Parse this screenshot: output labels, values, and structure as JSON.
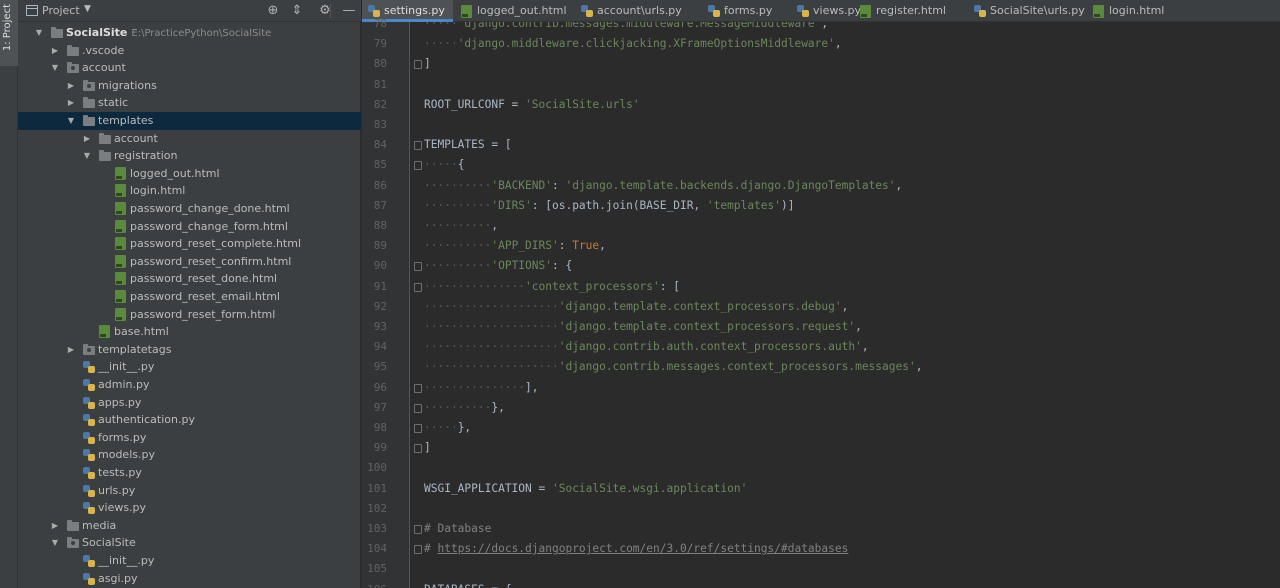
{
  "tool_strip": {
    "label": "1: Project"
  },
  "project_panel": {
    "title": "Project",
    "tree": [
      {
        "label": "SocialSite",
        "hint": "E:\\PracticePython\\SocialSite",
        "depth": 0,
        "kind": "folder",
        "expanded": true,
        "bold": true
      },
      {
        "label": ".vscode",
        "depth": 1,
        "kind": "folder",
        "expanded": false
      },
      {
        "label": "account",
        "depth": 1,
        "kind": "folder-pkg",
        "expanded": true
      },
      {
        "label": "migrations",
        "depth": 2,
        "kind": "folder-pkg",
        "expanded": false
      },
      {
        "label": "static",
        "depth": 2,
        "kind": "folder",
        "expanded": false
      },
      {
        "label": "templates",
        "depth": 2,
        "kind": "folder",
        "expanded": true,
        "selected": true
      },
      {
        "label": "account",
        "depth": 3,
        "kind": "folder",
        "expanded": false
      },
      {
        "label": "registration",
        "depth": 3,
        "kind": "folder",
        "expanded": true
      },
      {
        "label": "logged_out.html",
        "depth": 4,
        "kind": "html"
      },
      {
        "label": "login.html",
        "depth": 4,
        "kind": "html"
      },
      {
        "label": "password_change_done.html",
        "depth": 4,
        "kind": "html"
      },
      {
        "label": "password_change_form.html",
        "depth": 4,
        "kind": "html"
      },
      {
        "label": "password_reset_complete.html",
        "depth": 4,
        "kind": "html"
      },
      {
        "label": "password_reset_confirm.html",
        "depth": 4,
        "kind": "html"
      },
      {
        "label": "password_reset_done.html",
        "depth": 4,
        "kind": "html"
      },
      {
        "label": "password_reset_email.html",
        "depth": 4,
        "kind": "html"
      },
      {
        "label": "password_reset_form.html",
        "depth": 4,
        "kind": "html"
      },
      {
        "label": "base.html",
        "depth": 3,
        "kind": "html"
      },
      {
        "label": "templatetags",
        "depth": 2,
        "kind": "folder-pkg",
        "expanded": false
      },
      {
        "label": "__init__.py",
        "depth": 2,
        "kind": "py"
      },
      {
        "label": "admin.py",
        "depth": 2,
        "kind": "py"
      },
      {
        "label": "apps.py",
        "depth": 2,
        "kind": "py"
      },
      {
        "label": "authentication.py",
        "depth": 2,
        "kind": "py"
      },
      {
        "label": "forms.py",
        "depth": 2,
        "kind": "py"
      },
      {
        "label": "models.py",
        "depth": 2,
        "kind": "py"
      },
      {
        "label": "tests.py",
        "depth": 2,
        "kind": "py"
      },
      {
        "label": "urls.py",
        "depth": 2,
        "kind": "py"
      },
      {
        "label": "views.py",
        "depth": 2,
        "kind": "py"
      },
      {
        "label": "media",
        "depth": 1,
        "kind": "folder",
        "expanded": false
      },
      {
        "label": "SocialSite",
        "depth": 1,
        "kind": "folder-pkg",
        "expanded": true
      },
      {
        "label": "__init__.py",
        "depth": 2,
        "kind": "py"
      },
      {
        "label": "asgi.py",
        "depth": 2,
        "kind": "py"
      }
    ]
  },
  "tabs": [
    {
      "label": "settings.py",
      "kind": "py",
      "active": true
    },
    {
      "label": "logged_out.html",
      "kind": "html"
    },
    {
      "label": "account\\urls.py",
      "kind": "py"
    },
    {
      "label": "forms.py",
      "kind": "py"
    },
    {
      "label": "views.py",
      "kind": "py"
    },
    {
      "label": "register.html",
      "kind": "html"
    },
    {
      "label": "SocialSite\\urls.py",
      "kind": "py"
    },
    {
      "label": "login.html",
      "kind": "html"
    }
  ],
  "editor": {
    "lines": [
      {
        "n": "78",
        "indent": 1,
        "tokens": [
          [
            "str",
            "'django.contrib.messages.middleware.MessageMiddleware'"
          ],
          [
            "id",
            ","
          ]
        ]
      },
      {
        "n": "79",
        "indent": 1,
        "tokens": [
          [
            "str",
            "'django.middleware.clickjacking.XFrameOptionsMiddleware'"
          ],
          [
            "id",
            ","
          ]
        ]
      },
      {
        "n": "80",
        "indent": 0,
        "tokens": [
          [
            "id",
            "]"
          ]
        ],
        "fold": true
      },
      {
        "n": "81",
        "indent": 0,
        "tokens": []
      },
      {
        "n": "82",
        "indent": 0,
        "tokens": [
          [
            "id",
            "ROOT_URLCONF = "
          ],
          [
            "str",
            "'SocialSite.urls'"
          ]
        ]
      },
      {
        "n": "83",
        "indent": 0,
        "tokens": []
      },
      {
        "n": "84",
        "indent": 0,
        "tokens": [
          [
            "id",
            "TEMPLATES = ["
          ]
        ],
        "fold": true
      },
      {
        "n": "85",
        "indent": 1,
        "tokens": [
          [
            "id",
            "{"
          ]
        ],
        "fold": true
      },
      {
        "n": "86",
        "indent": 2,
        "tokens": [
          [
            "str",
            "'BACKEND'"
          ],
          [
            "id",
            ": "
          ],
          [
            "str",
            "'django.template.backends.django.DjangoTemplates'"
          ],
          [
            "id",
            ","
          ]
        ]
      },
      {
        "n": "87",
        "indent": 2,
        "tokens": [
          [
            "str",
            "'DIRS'"
          ],
          [
            "id",
            ": [os.path.join(BASE_DIR, "
          ],
          [
            "str",
            "'templates'"
          ],
          [
            "id",
            ")]"
          ]
        ]
      },
      {
        "n": "88",
        "indent": 2,
        "tokens": [
          [
            "id",
            ","
          ]
        ]
      },
      {
        "n": "89",
        "indent": 2,
        "tokens": [
          [
            "str",
            "'APP_DIRS'"
          ],
          [
            "id",
            ": "
          ],
          [
            "kw",
            "True"
          ],
          [
            "id",
            ","
          ]
        ]
      },
      {
        "n": "90",
        "indent": 2,
        "tokens": [
          [
            "str",
            "'OPTIONS'"
          ],
          [
            "id",
            ": {"
          ]
        ],
        "fold": true
      },
      {
        "n": "91",
        "indent": 3,
        "tokens": [
          [
            "str",
            "'context_processors'"
          ],
          [
            "id",
            ": ["
          ]
        ],
        "fold": true
      },
      {
        "n": "92",
        "indent": 4,
        "tokens": [
          [
            "str",
            "'django.template.context_processors.debug'"
          ],
          [
            "id",
            ","
          ]
        ]
      },
      {
        "n": "93",
        "indent": 4,
        "tokens": [
          [
            "str",
            "'django.template.context_processors.request'"
          ],
          [
            "id",
            ","
          ]
        ]
      },
      {
        "n": "94",
        "indent": 4,
        "tokens": [
          [
            "str",
            "'django.contrib.auth.context_processors.auth'"
          ],
          [
            "id",
            ","
          ]
        ]
      },
      {
        "n": "95",
        "indent": 4,
        "tokens": [
          [
            "str",
            "'django.contrib.messages.context_processors.messages'"
          ],
          [
            "id",
            ","
          ]
        ]
      },
      {
        "n": "96",
        "indent": 3,
        "tokens": [
          [
            "id",
            "],"
          ]
        ],
        "fold": true
      },
      {
        "n": "97",
        "indent": 2,
        "tokens": [
          [
            "id",
            "},"
          ]
        ],
        "fold": true
      },
      {
        "n": "98",
        "indent": 1,
        "tokens": [
          [
            "id",
            "},"
          ]
        ],
        "fold": true
      },
      {
        "n": "99",
        "indent": 0,
        "tokens": [
          [
            "id",
            "]"
          ]
        ],
        "fold": true
      },
      {
        "n": "100",
        "indent": 0,
        "tokens": []
      },
      {
        "n": "101",
        "indent": 0,
        "tokens": [
          [
            "id",
            "WSGI_APPLICATION = "
          ],
          [
            "str",
            "'SocialSite.wsgi.application'"
          ]
        ]
      },
      {
        "n": "102",
        "indent": 0,
        "tokens": []
      },
      {
        "n": "103",
        "indent": 0,
        "tokens": [
          [
            "cm",
            "# Database"
          ]
        ],
        "fold": true
      },
      {
        "n": "104",
        "indent": 0,
        "tokens": [
          [
            "cm",
            "# "
          ],
          [
            "lnk",
            "https://docs.djangoproject.com/en/3.0/ref/settings/#databases"
          ]
        ],
        "fold": true
      },
      {
        "n": "105",
        "indent": 0,
        "tokens": []
      },
      {
        "n": "106",
        "indent": 0,
        "tokens": [
          [
            "id",
            "DATABASES = {"
          ]
        ]
      }
    ]
  }
}
